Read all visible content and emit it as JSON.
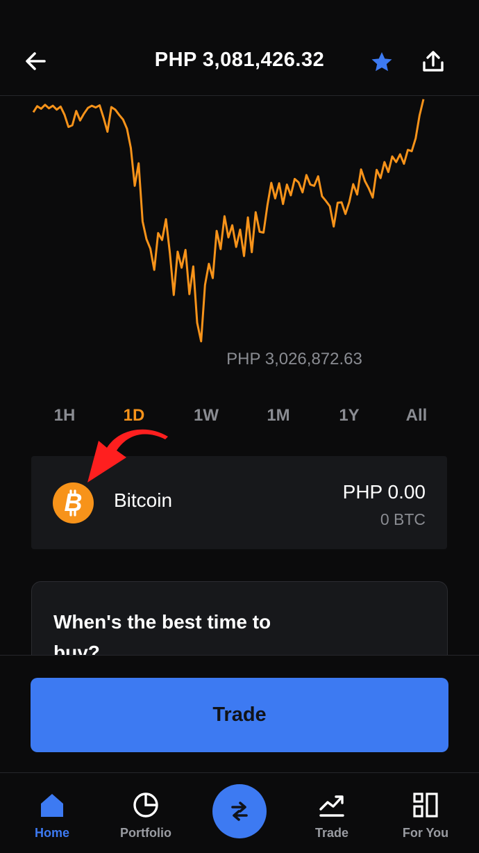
{
  "header": {
    "price": "PHP 3,081,426.32",
    "back_icon": "arrow-left-icon",
    "star_icon": "star-icon",
    "share_icon": "share-icon"
  },
  "chart": {
    "low_label": "PHP 3,026,872.63",
    "line_color": "#f7931a"
  },
  "chart_data": {
    "type": "line",
    "series": [
      {
        "values": [
          3079800,
          3081200,
          3080600,
          3081500,
          3080700,
          3081300,
          3080400,
          3081100,
          3079200,
          3076400,
          3076800,
          3080100,
          3077900,
          3079500,
          3080800,
          3081300,
          3080900,
          3081400,
          3078500,
          3075300,
          3081000,
          3080400,
          3079200,
          3078100,
          3076000,
          3071500,
          3062800,
          3068000,
          3054600,
          3050500,
          3048300,
          3043400,
          3051900,
          3050300,
          3055100,
          3047300,
          3037600,
          3047600,
          3043900,
          3048000,
          3037800,
          3044200,
          3031200,
          3026900,
          3039900,
          3044800,
          3041500,
          3052400,
          3048200,
          3055800,
          3050900,
          3053700,
          3048700,
          3052700,
          3046600,
          3055500,
          3047500,
          3056700,
          3052200,
          3052000,
          3058300,
          3063500,
          3059900,
          3063400,
          3058600,
          3063100,
          3060600,
          3064400,
          3063600,
          3061300,
          3065300,
          3063100,
          3062800,
          3065000,
          3060400,
          3059300,
          3058100,
          3053400,
          3058900,
          3059000,
          3056300,
          3059100,
          3063200,
          3060800,
          3066600,
          3063900,
          3062200,
          3060100,
          3066500,
          3064600,
          3068300,
          3066000,
          3069600,
          3068300,
          3070100,
          3067900,
          3071100,
          3070800,
          3073800,
          3079100,
          3082800
        ]
      }
    ],
    "annotations": [
      "PHP 3,026,872.63"
    ],
    "grid": false,
    "legend": "none"
  },
  "ranges": {
    "items": [
      "1H",
      "1D",
      "1W",
      "1M",
      "1Y",
      "All"
    ],
    "active": "1D"
  },
  "asset": {
    "name": "Bitcoin",
    "value": "PHP 0.00",
    "quantity": "0 BTC",
    "logo_icon": "bitcoin-icon",
    "logo_color": "#f7931a"
  },
  "annotation": {
    "arrow_icon": "curved-arrow-icon",
    "color": "#ff1f1f"
  },
  "info_card": {
    "title": "When's the best time to buy?"
  },
  "trade_button": {
    "label": "Trade",
    "color": "#3d7af2"
  },
  "nav": {
    "home": "Home",
    "portfolio": "Portfolio",
    "trade": "Trade",
    "for_you": "For You",
    "center_icon": "swap-icon"
  },
  "colors": {
    "background": "#0b0b0c",
    "card": "#17181b",
    "accent": "#3d7af2",
    "muted": "#8a8c92"
  }
}
